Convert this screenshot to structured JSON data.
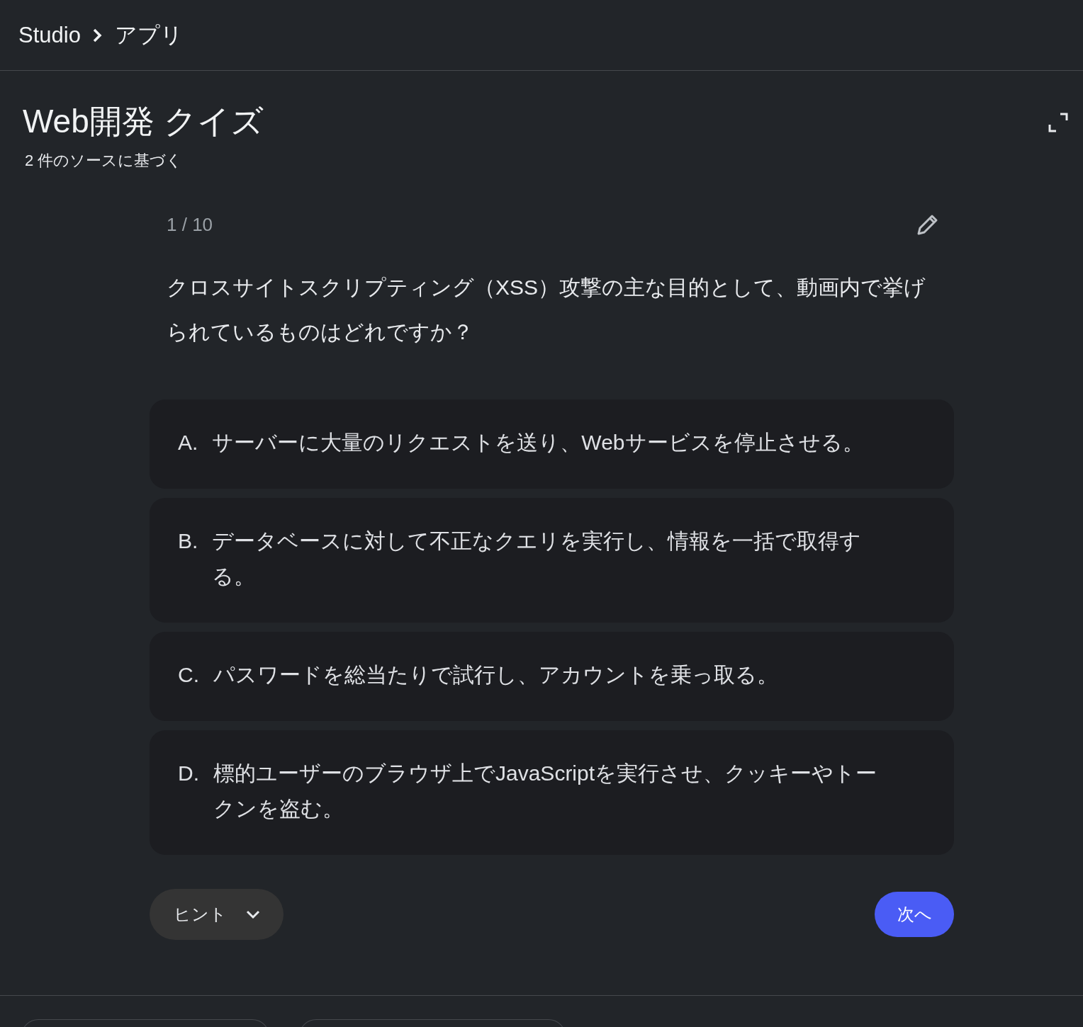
{
  "breadcrumb": [
    {
      "label": "Studio"
    },
    {
      "label": "アプリ"
    }
  ],
  "quiz": {
    "title": "Web開発 クイズ",
    "subtitle": "2 件のソースに基づく",
    "counter": "1 / 10",
    "question": "クロスサイトスクリプティング（XSS）攻撃の主な目的として、動画内で挙げられているものはどれですか？",
    "options": [
      {
        "letter": "A.",
        "text": "サーバーに大量のリクエストを送り、Webサービスを停止させる。"
      },
      {
        "letter": "B.",
        "text": "データベースに対して不正なクエリを実行し、情報を一括で取得する。"
      },
      {
        "letter": "C.",
        "text": "パスワードを総当たりで試行し、アカウントを乗っ取る。"
      },
      {
        "letter": "D.",
        "text": "標的ユーザーのブラウザ上でJavaScriptを実行させ、クッキーやトークンを盗む。"
      }
    ],
    "hint_button": "ヒント",
    "next_button": "次へ"
  }
}
